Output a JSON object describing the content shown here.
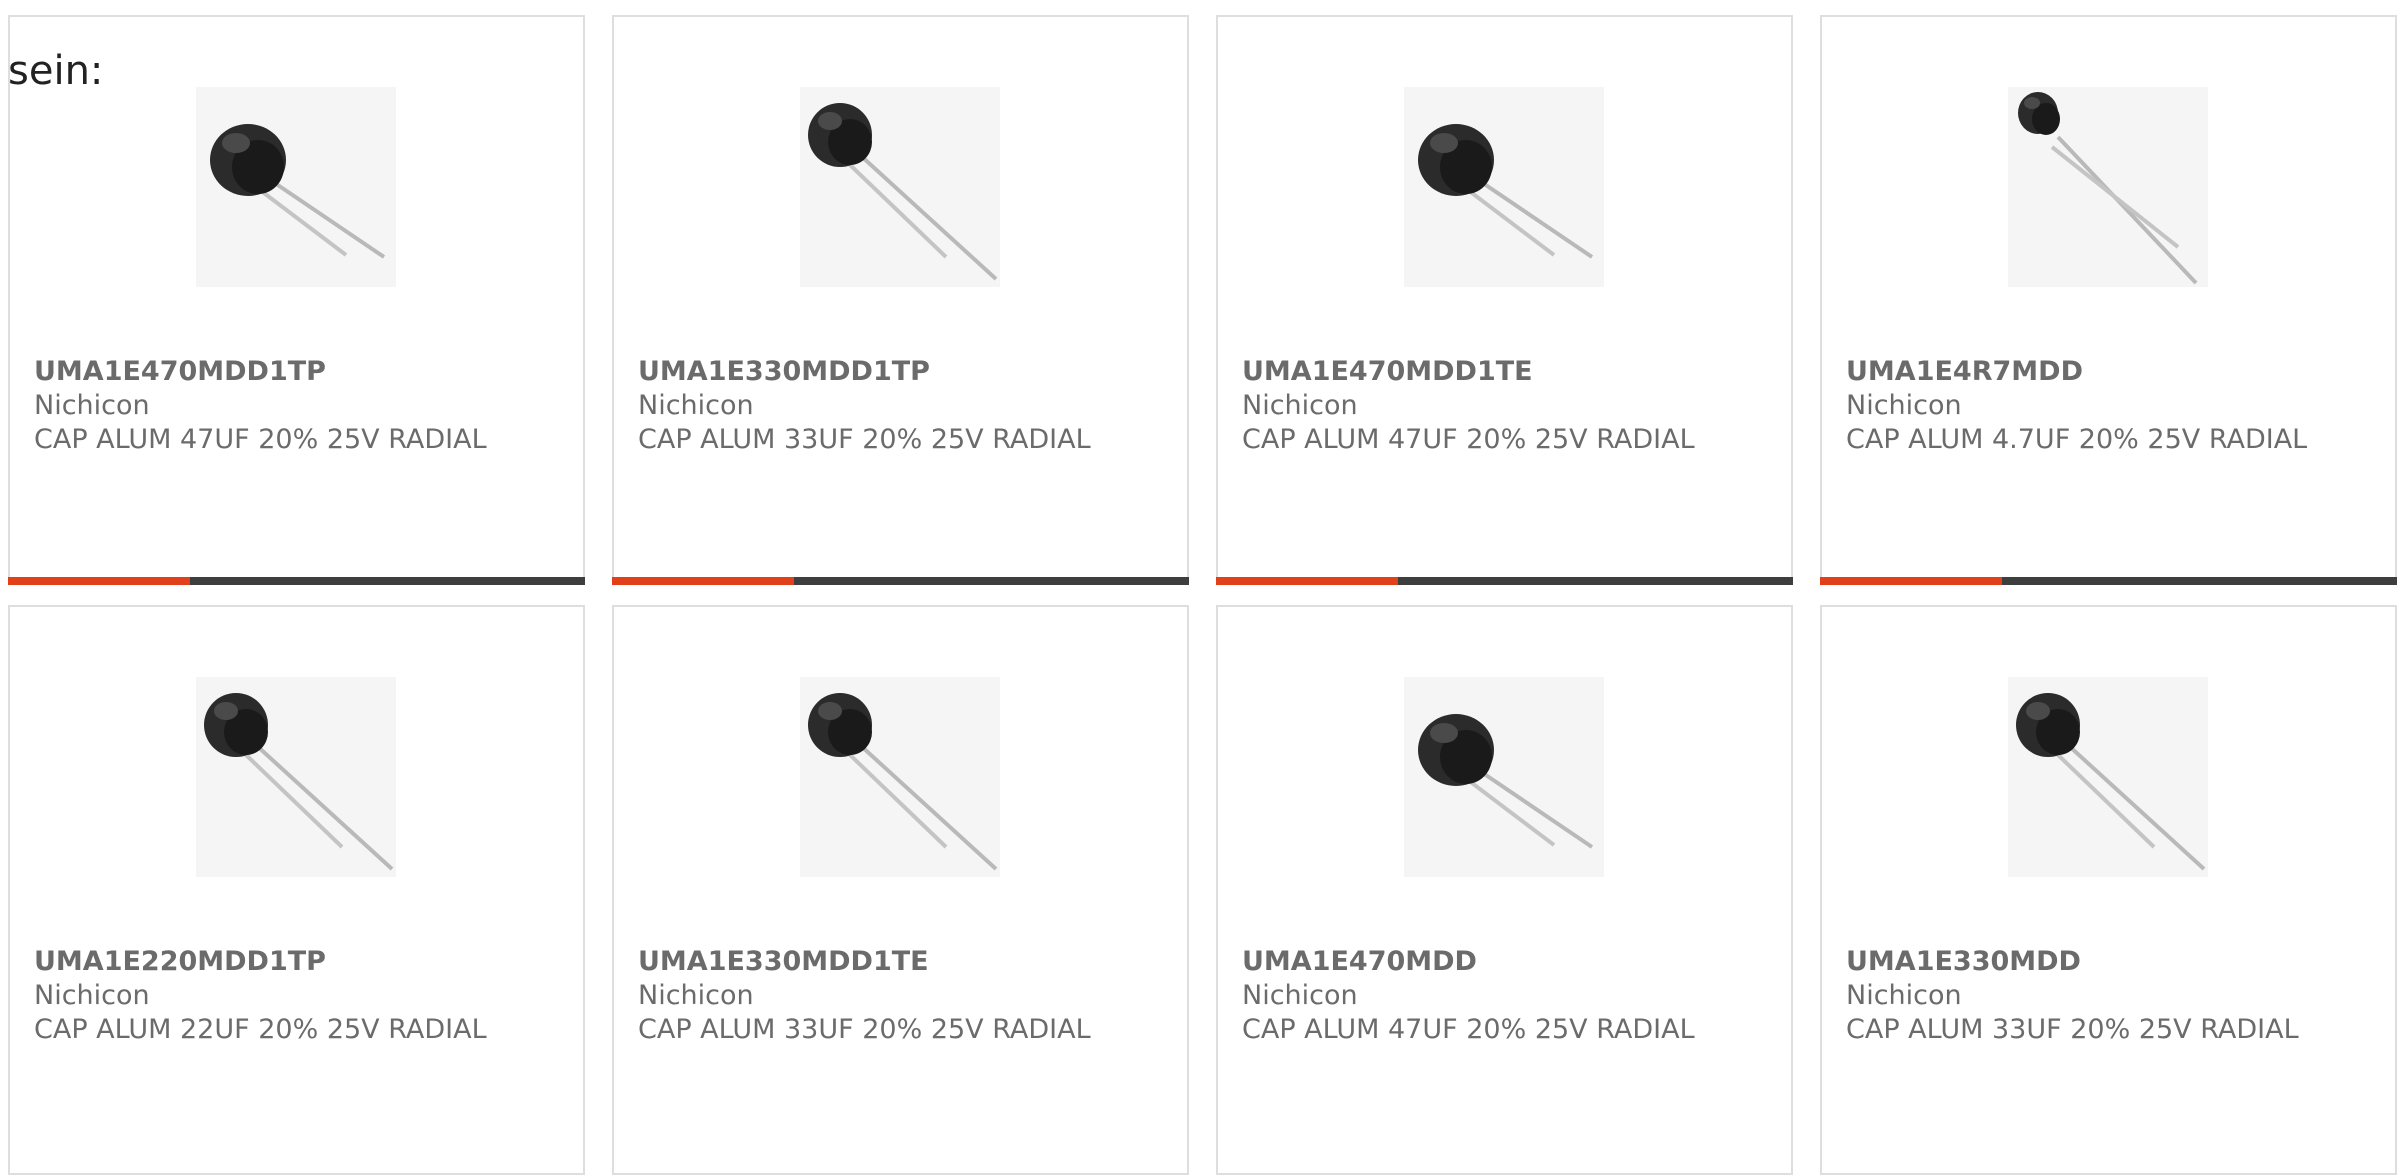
{
  "intro_text": "sein:",
  "colors": {
    "accent": "#e2401b",
    "bar": "#3e3e3e",
    "text": "#6b6b6b",
    "border": "#dedede"
  },
  "products": [
    {
      "part": "UMA1E470MDD1TP",
      "manufacturer": "Nichicon",
      "description": "CAP ALUM 47UF 20% 25V RADIAL",
      "image_icon": "capacitor-image"
    },
    {
      "part": "UMA1E330MDD1TP",
      "manufacturer": "Nichicon",
      "description": "CAP ALUM 33UF 20% 25V RADIAL",
      "image_icon": "capacitor-image"
    },
    {
      "part": "UMA1E470MDD1TE",
      "manufacturer": "Nichicon",
      "description": "CAP ALUM 47UF 20% 25V RADIAL",
      "image_icon": "capacitor-image"
    },
    {
      "part": "UMA1E4R7MDD",
      "manufacturer": "Nichicon",
      "description": "CAP ALUM 4.7UF 20% 25V RADIAL",
      "image_icon": "capacitor-image"
    },
    {
      "part": "UMA1E220MDD1TP",
      "manufacturer": "Nichicon",
      "description": "CAP ALUM 22UF 20% 25V RADIAL",
      "image_icon": "capacitor-image"
    },
    {
      "part": "UMA1E330MDD1TE",
      "manufacturer": "Nichicon",
      "description": "CAP ALUM 33UF 20% 25V RADIAL",
      "image_icon": "capacitor-image"
    },
    {
      "part": "UMA1E470MDD",
      "manufacturer": "Nichicon",
      "description": "CAP ALUM 47UF 20% 25V RADIAL",
      "image_icon": "capacitor-image"
    },
    {
      "part": "UMA1E330MDD",
      "manufacturer": "Nichicon",
      "description": "CAP ALUM 33UF 20% 25V RADIAL",
      "image_icon": "capacitor-image"
    }
  ]
}
